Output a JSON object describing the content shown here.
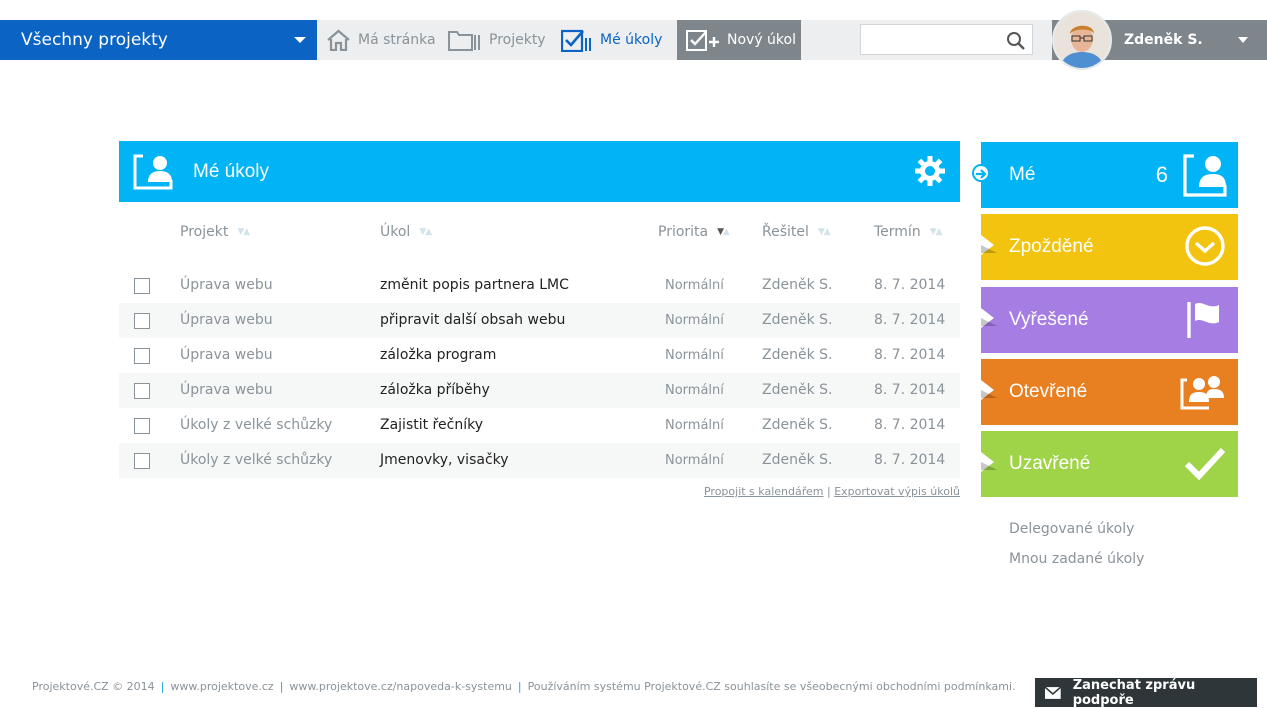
{
  "topbar": {
    "project_selector": "Všechny projekty",
    "nav": {
      "home": "Má stránka",
      "projects": "Projekty",
      "my_tasks": "Mé úkoly"
    },
    "new_task": "Nový úkol",
    "search_placeholder": "",
    "user_name": "Zdeněk S."
  },
  "panel": {
    "title": "Mé úkoly",
    "columns": {
      "project": "Projekt",
      "task": "Úkol",
      "priority": "Priorita",
      "resolver": "Řešitel",
      "deadline": "Termín"
    },
    "rows": [
      {
        "project": "Úprava webu",
        "task": "změnit popis partnera LMC",
        "priority": "Normální",
        "resolver": "Zdeněk S.",
        "deadline": "8. 7. 2014"
      },
      {
        "project": "Úprava webu",
        "task": "připravit další obsah webu",
        "priority": "Normální",
        "resolver": "Zdeněk S.",
        "deadline": "8. 7. 2014"
      },
      {
        "project": "Úprava webu",
        "task": "záložka program",
        "priority": "Normální",
        "resolver": "Zdeněk S.",
        "deadline": "8. 7. 2014"
      },
      {
        "project": "Úprava webu",
        "task": "záložka příběhy",
        "priority": "Normální",
        "resolver": "Zdeněk S.",
        "deadline": "8. 7. 2014"
      },
      {
        "project": "Úkoly z velké schůzky",
        "task": "Zajistit řečníky",
        "priority": "Normální",
        "resolver": "Zdeněk S.",
        "deadline": "8. 7. 2014"
      },
      {
        "project": "Úkoly z velké schůzky",
        "task": "Jmenovky, visačky",
        "priority": "Normální",
        "resolver": "Zdeněk S.",
        "deadline": "8. 7. 2014"
      }
    ],
    "link_calendar": "Propojit s kalendářem",
    "link_separator": "|",
    "link_export": "Exportovat výpis úkolů"
  },
  "filters": {
    "mine": {
      "label": "Mé",
      "count": "6",
      "color": "#00b4f5"
    },
    "delayed": {
      "label": "Zpožděné",
      "color": "#f2c40f"
    },
    "resolved": {
      "label": "Vyřešené",
      "color": "#a57de3"
    },
    "open": {
      "label": "Otevřené",
      "color": "#e87f21"
    },
    "closed": {
      "label": "Uzavřené",
      "color": "#9fd449"
    },
    "delegated": "Delegované úkoly",
    "assigned_by_me": "Mnou zadané úkoly"
  },
  "footer": {
    "copyright": "Projektové.CZ © 2014",
    "site": "www.projektove.cz",
    "help": "www.projektove.cz/napoveda-k-systemu",
    "terms": "Používáním systému Projektové.CZ souhlasíte se všeobecnými obchodními podmínkami.",
    "separator": "|"
  },
  "support": {
    "label": "Zanechat zprávu podpoře"
  },
  "icons": {
    "home": "home-icon",
    "projects": "folder-icon",
    "my_tasks": "checklist-icon",
    "new_task": "new-task-icon",
    "search": "search-icon",
    "gear": "gear-icon",
    "mail": "mail-icon"
  }
}
